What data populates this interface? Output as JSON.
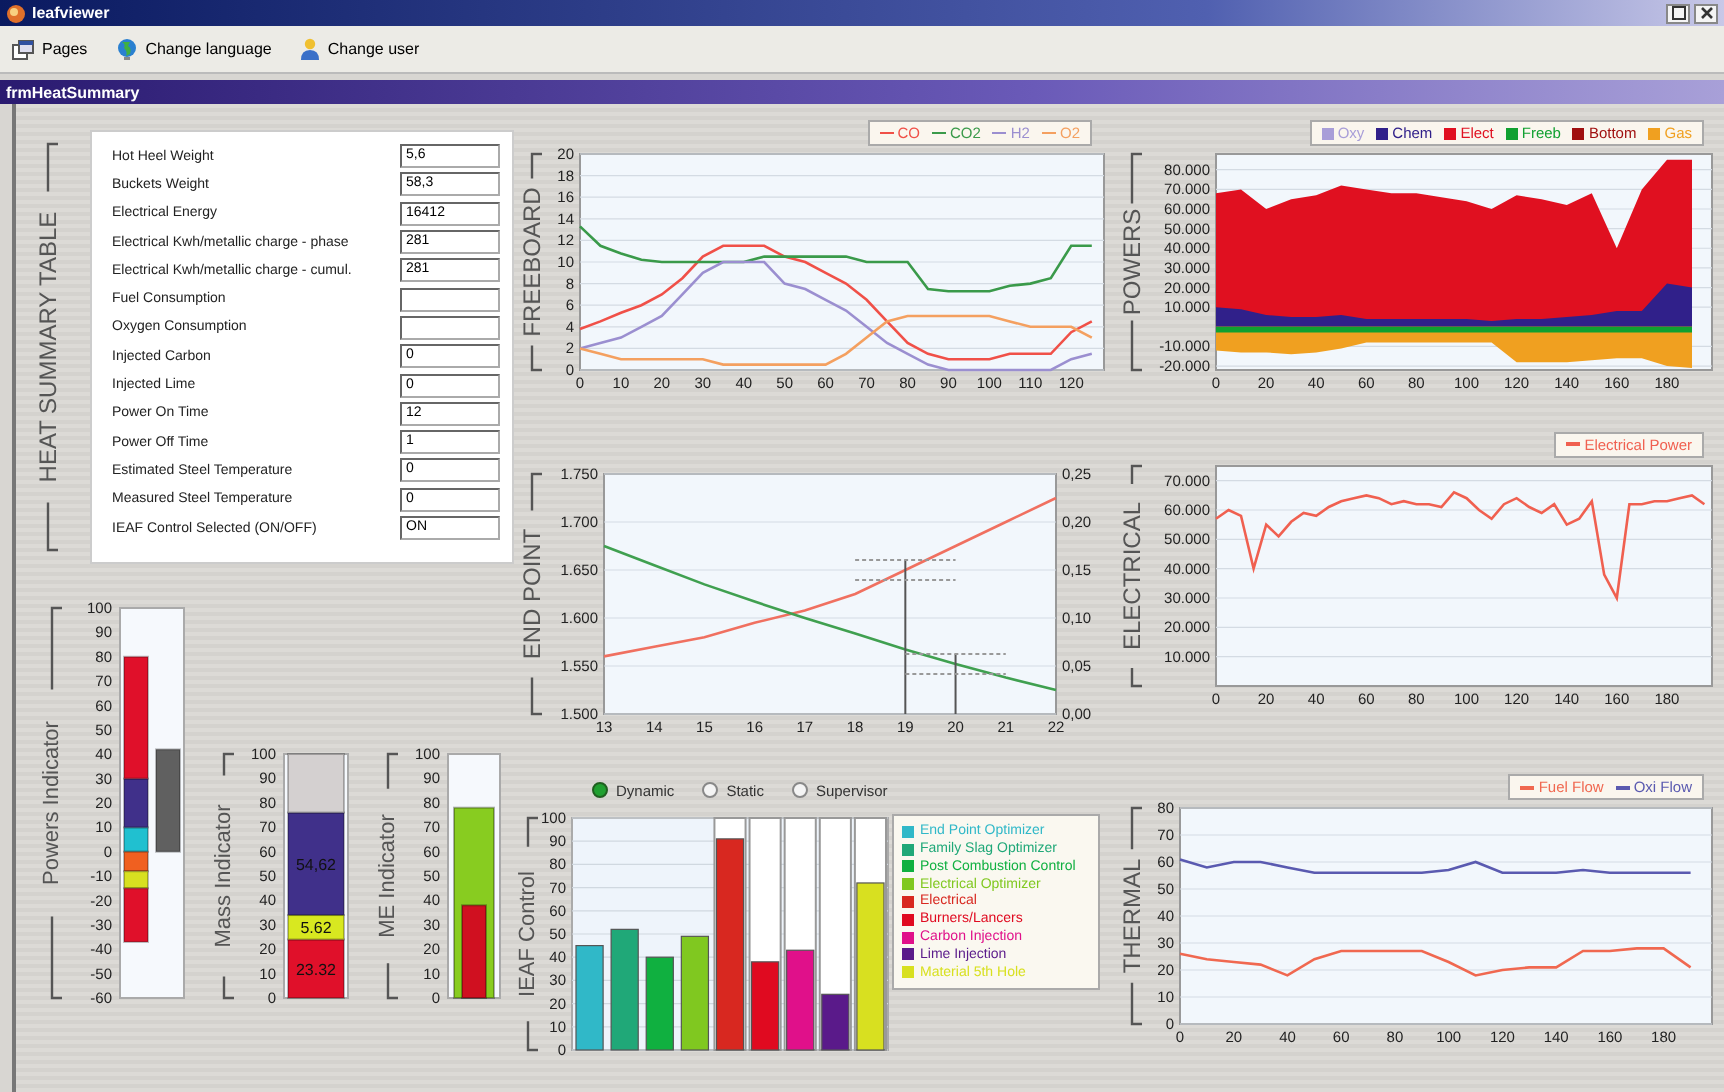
{
  "window": {
    "title": "Ieafviewer"
  },
  "menu": [
    {
      "label": "Pages",
      "kind": "pages"
    },
    {
      "label": "Change language",
      "kind": "globe"
    },
    {
      "label": "Change user",
      "kind": "user"
    }
  ],
  "form": {
    "title": "frmHeatSummary"
  },
  "heat_summary": {
    "title": "HEAT SUMMARY TABLE",
    "rows": [
      {
        "label": "Hot Heel Weight",
        "value": "5,6"
      },
      {
        "label": "Buckets Weight",
        "value": "58,3"
      },
      {
        "label": "Electrical Energy",
        "value": "16412"
      },
      {
        "label": "Electrical Kwh/metallic charge - phase",
        "value": "281"
      },
      {
        "label": "Electrical Kwh/metallic charge - cumul.",
        "value": "281"
      },
      {
        "label": "Fuel Consumption"
      },
      {
        "label": "Oxygen Consumption"
      },
      {
        "label": "Injected Carbon",
        "value": "0"
      },
      {
        "label": "Injected Lime",
        "value": "0"
      },
      {
        "label": "Power On Time",
        "value": "12"
      },
      {
        "label": "Power Off Time",
        "value": "1"
      },
      {
        "label": "Estimated Steel Temperature",
        "value": "0"
      },
      {
        "label": "Measured Steel Temperature",
        "value": "0"
      },
      {
        "label": "IEAF Control Selected (ON/OFF)",
        "value": "ON"
      }
    ]
  },
  "powers_indicator": {
    "chart_data": {
      "type": "bar",
      "stacked": true,
      "categories": [
        null,
        null
      ],
      "ylabel": "Powers Indicator",
      "ylim": [
        -60,
        100
      ],
      "yticks": [
        -60,
        -50,
        -40,
        -30,
        -20,
        -10,
        0,
        10,
        20,
        30,
        40,
        50,
        60,
        70,
        80,
        90,
        100
      ],
      "series": [
        {
          "color": "#20c0d0",
          "values": [
            10,
            null
          ]
        },
        {
          "color": "#40308a",
          "values": [
            20,
            null
          ]
        },
        {
          "color": "#e0102a",
          "values": [
            50,
            null
          ]
        },
        {
          "color": "#f06020",
          "values": [
            -8,
            null
          ]
        },
        {
          "color": "#d8e020",
          "values": [
            -7,
            null
          ]
        },
        {
          "color": "#e0102a",
          "values": [
            -22,
            null
          ]
        },
        {
          "color": "#606060",
          "values": [
            null,
            42
          ]
        }
      ]
    }
  },
  "mass_indicator": {
    "chart_data": {
      "type": "bar",
      "stacked": true,
      "categories": [
        null
      ],
      "ylabel": "Mass Indicator",
      "ylim": [
        0,
        100
      ],
      "yticks": [
        0,
        10,
        20,
        30,
        40,
        50,
        60,
        70,
        80,
        90,
        100
      ],
      "value_labels": [
        "23.32",
        "5.62",
        "54,62"
      ],
      "series": [
        {
          "color": "#e0102a",
          "values": [
            24
          ]
        },
        {
          "color": "#d8e820",
          "values": [
            10
          ]
        },
        {
          "color": "#40308a",
          "values": [
            42
          ]
        },
        {
          "color": "#d4d0d0",
          "values": [
            24
          ]
        }
      ]
    }
  },
  "me_indicator": {
    "title": "ME Indicator",
    "scale": [
      "100",
      "90",
      "80",
      "70",
      "60",
      "50",
      "40",
      "30",
      "20",
      "10",
      "0"
    ],
    "bars": [
      {
        "color": "#88cc20",
        "level": 0.78
      },
      {
        "color": "#d01020",
        "level": 0.38
      }
    ]
  },
  "freeboard": {
    "chart_data": {
      "type": "line",
      "grid": true,
      "ylabel": "FREEBOARD",
      "xlim": [
        0,
        128
      ],
      "ylim": [
        0,
        20
      ],
      "xticks": [
        0,
        10,
        20,
        30,
        40,
        50,
        60,
        70,
        80,
        90,
        100,
        110,
        120
      ],
      "yticks": [
        0,
        2,
        4,
        6,
        8,
        10,
        12,
        14,
        16,
        18,
        20
      ],
      "x": [
        0,
        5,
        10,
        15,
        20,
        25,
        30,
        35,
        40,
        45,
        50,
        55,
        60,
        65,
        70,
        75,
        80,
        85,
        90,
        95,
        100,
        105,
        110,
        115,
        120,
        125
      ],
      "series": [
        {
          "name": "CO",
          "color": "#f05048",
          "values": [
            3.8,
            4.5,
            5.3,
            6,
            7,
            8.5,
            10.5,
            11.5,
            11.5,
            11.5,
            10.5,
            10,
            9,
            8,
            6.5,
            4.5,
            2.5,
            1.5,
            1,
            1,
            1,
            1.5,
            1.5,
            1.5,
            3.5,
            4.5
          ]
        },
        {
          "name": "CO2",
          "color": "#3a9a4a",
          "values": [
            13.3,
            11.5,
            10.8,
            10.2,
            10,
            10,
            10,
            10,
            10,
            10.5,
            10.5,
            10.5,
            10.5,
            10.5,
            10,
            10,
            10,
            7.5,
            7.3,
            7.3,
            7.3,
            7.8,
            8,
            8.5,
            11.5,
            11.5
          ]
        },
        {
          "name": "H2",
          "color": "#9b8fd0",
          "values": [
            2,
            2.5,
            3,
            4,
            5,
            7,
            9,
            10,
            10,
            10,
            8,
            7.5,
            6.5,
            5.5,
            4,
            2.5,
            1.5,
            0.5,
            0,
            0,
            0,
            0,
            0,
            0,
            1,
            1.5
          ]
        },
        {
          "name": "O2",
          "color": "#f4a060",
          "values": [
            2,
            1.5,
            1,
            1,
            1,
            1,
            1,
            0.5,
            0.5,
            0.5,
            0.5,
            0.5,
            0.5,
            1.5,
            3,
            4.5,
            5,
            5,
            5,
            5,
            5,
            4.5,
            4,
            4,
            4,
            3
          ]
        }
      ]
    }
  },
  "powers": {
    "legend": [
      {
        "label": "Oxy",
        "color": "#a89ed8"
      },
      {
        "label": "Chem",
        "color": "#30208a"
      },
      {
        "label": "Elect",
        "color": "#e01020"
      },
      {
        "label": "Freeb",
        "color": "#10a030"
      },
      {
        "label": "Bottom",
        "color": "#a01010"
      },
      {
        "label": "Gas",
        "color": "#f0a020"
      }
    ],
    "chart_data": {
      "type": "area",
      "stacked": false,
      "grid": true,
      "ylabel": "POWERS",
      "xlim": [
        0,
        198
      ],
      "ylim": [
        -22000,
        88000
      ],
      "xticks": [
        0,
        20,
        40,
        60,
        80,
        100,
        120,
        140,
        160,
        180
      ],
      "yticks": [
        {
          "value": -20000,
          "label": "-20.000"
        },
        {
          "value": -10000,
          "label": "-10.000"
        },
        {
          "value": 10000,
          "label": "10.000"
        },
        {
          "value": 20000,
          "label": "20.000"
        },
        {
          "value": 30000,
          "label": "30.000"
        },
        {
          "value": 40000,
          "label": "40.000"
        },
        {
          "value": 50000,
          "label": "50.000"
        },
        {
          "value": 60000,
          "label": "60.000"
        },
        {
          "value": 70000,
          "label": "70.000"
        },
        {
          "value": 80000,
          "label": "80.000"
        }
      ],
      "x": [
        0,
        10,
        20,
        30,
        40,
        50,
        60,
        70,
        80,
        90,
        100,
        110,
        120,
        130,
        140,
        150,
        160,
        170,
        180,
        190
      ],
      "series": [
        {
          "color": "#e01020",
          "values": [
            68000,
            70000,
            60000,
            65000,
            67000,
            72000,
            70000,
            68000,
            68000,
            66000,
            64000,
            60000,
            67000,
            65000,
            62000,
            68000,
            40000,
            70000,
            85000,
            85000
          ]
        },
        {
          "color": "#30208a",
          "values": [
            10000,
            9000,
            6000,
            5000,
            5000,
            6000,
            4000,
            4000,
            4000,
            4000,
            4000,
            3000,
            4000,
            4000,
            5000,
            6000,
            8000,
            8000,
            22000,
            20000
          ]
        },
        {
          "color": "#f0a020",
          "values": [
            -12000,
            -13000,
            -13000,
            -14000,
            -13000,
            -11000,
            -8000,
            -8000,
            -8000,
            -8000,
            -8000,
            -8000,
            -18000,
            -18000,
            -18000,
            -17000,
            -16000,
            -16000,
            -20000,
            -21000
          ]
        },
        {
          "color": "#10a030",
          "values": [
            -3000,
            -3000,
            -3000,
            -3000,
            -3000,
            -3000,
            -3000,
            -3000,
            -3000,
            -3000,
            -3000,
            -3000,
            -3000,
            -3000,
            -3000,
            -3000,
            -3000,
            -3000,
            -3000,
            -3000
          ]
        }
      ]
    }
  },
  "end_point": {
    "chart_data": {
      "type": "line",
      "grid": true,
      "ylabel": "END POINT",
      "xlim": [
        13,
        22
      ],
      "ylim": [
        1500,
        1750
      ],
      "xticks": [
        13,
        14,
        15,
        16,
        17,
        18,
        19,
        20,
        21,
        22
      ],
      "yticks": [
        {
          "value": 1500,
          "label": "1.500"
        },
        {
          "value": 1550,
          "label": "1.550"
        },
        {
          "value": 1600,
          "label": "1.600"
        },
        {
          "value": 1650,
          "label": "1.650"
        },
        {
          "value": 1700,
          "label": "1.700"
        },
        {
          "value": 1750,
          "label": "1.750"
        }
      ],
      "y2lim": [
        0,
        0.25
      ],
      "y2ticks": [
        {
          "value": 0,
          "label": "0,00"
        },
        {
          "value": 0.05,
          "label": "0,05"
        },
        {
          "value": 0.1,
          "label": "0,10"
        },
        {
          "value": 0.15,
          "label": "0,15"
        },
        {
          "value": 0.2,
          "label": "0,20"
        },
        {
          "value": 0.25,
          "label": "0,25"
        }
      ],
      "x": [
        13,
        14,
        15,
        16,
        17,
        18,
        19,
        20,
        21,
        22
      ],
      "series": [
        {
          "color": "#f07060",
          "values": [
            1560,
            1570,
            1580,
            1595,
            1608,
            1625,
            1650,
            1675,
            1700,
            1725
          ]
        },
        {
          "color": "#40a050",
          "values": [
            1675,
            1655,
            1635,
            1617,
            1600,
            1584,
            1567,
            1552,
            1538,
            1525
          ]
        }
      ],
      "ref_lines": [
        {
          "axis": "x",
          "value": 19
        },
        {
          "axis": "x",
          "value": 20
        }
      ]
    }
  },
  "electrical": {
    "chart_data": {
      "type": "line",
      "grid": true,
      "ylabel": "ELECTRICAL",
      "xlim": [
        0,
        198
      ],
      "ylim": [
        0,
        75000
      ],
      "xticks": [
        0,
        20,
        40,
        60,
        80,
        100,
        120,
        140,
        160,
        180
      ],
      "yticks": [
        {
          "value": 10000,
          "label": "10.000"
        },
        {
          "value": 20000,
          "label": "20.000"
        },
        {
          "value": 30000,
          "label": "30.000"
        },
        {
          "value": 40000,
          "label": "40.000"
        },
        {
          "value": 50000,
          "label": "50.000"
        },
        {
          "value": 60000,
          "label": "60.000"
        },
        {
          "value": 70000,
          "label": "70.000"
        }
      ],
      "x": [
        0,
        5,
        10,
        15,
        20,
        25,
        30,
        35,
        40,
        45,
        50,
        55,
        60,
        65,
        70,
        75,
        80,
        85,
        90,
        95,
        100,
        105,
        110,
        115,
        120,
        125,
        130,
        135,
        140,
        145,
        150,
        155,
        160,
        165,
        170,
        175,
        180,
        185,
        190,
        195
      ],
      "series": [
        {
          "name": "Electrical Power",
          "color": "#f06050",
          "values": [
            57000,
            60000,
            58000,
            40000,
            55000,
            51000,
            56000,
            59000,
            58000,
            61000,
            63000,
            64000,
            65000,
            64000,
            62000,
            63000,
            62000,
            62000,
            61000,
            66000,
            64000,
            60000,
            57000,
            62000,
            64000,
            61000,
            59000,
            62000,
            55000,
            57000,
            63000,
            38000,
            30000,
            62000,
            62000,
            63000,
            63000,
            64000,
            65000,
            62000
          ]
        }
      ]
    }
  },
  "ieaf": {
    "modes": [
      {
        "label": "Dynamic",
        "selected": true
      },
      {
        "label": "Static",
        "selected": false
      },
      {
        "label": "Supervisor",
        "selected": false
      }
    ],
    "legend": [
      {
        "label": "End Point Optimizer",
        "color": "#30b8c8",
        "boxed": false
      },
      {
        "label": "Family Slag Optimizer",
        "color": "#20a878",
        "boxed": false
      },
      {
        "label": "Post Combustion Control",
        "color": "#10b040",
        "boxed": false
      },
      {
        "label": "Electrical Optimizer",
        "color": "#80c820",
        "boxed": false
      },
      {
        "label": "Electrical",
        "color": "#d82820",
        "boxed": true
      },
      {
        "label": "Burners/Lancers",
        "color": "#e00a20",
        "boxed": true
      },
      {
        "label": "Carbon Injection",
        "color": "#e0108a",
        "boxed": true
      },
      {
        "label": "Lime Injection",
        "color": "#5a1a8a",
        "boxed": true
      },
      {
        "label": "Material 5th Hole",
        "color": "#d8e020",
        "boxed": true
      }
    ],
    "chart_data": {
      "type": "bar",
      "grid": true,
      "ylabel": "IEAF Control",
      "ylim": [
        0,
        100
      ],
      "yticks": [
        0,
        10,
        20,
        30,
        40,
        50,
        60,
        70,
        80,
        90,
        100
      ],
      "values": [
        45,
        52,
        40,
        49,
        91,
        38,
        43,
        24,
        72
      ]
    }
  },
  "thermal": {
    "chart_data": {
      "type": "line",
      "grid": true,
      "ylabel": "THERMAL",
      "xlim": [
        0,
        198
      ],
      "ylim": [
        0,
        80
      ],
      "xticks": [
        0,
        20,
        40,
        60,
        80,
        100,
        120,
        140,
        160,
        180
      ],
      "yticks": [
        0,
        10,
        20,
        30,
        40,
        50,
        60,
        70,
        80
      ],
      "x": [
        0,
        10,
        20,
        30,
        40,
        50,
        60,
        70,
        80,
        90,
        100,
        110,
        120,
        130,
        140,
        150,
        160,
        170,
        180,
        190
      ],
      "series": [
        {
          "name": "Fuel Flow",
          "color": "#f06850",
          "values": [
            26,
            24,
            23,
            22,
            18,
            24,
            27,
            27,
            27,
            27,
            23,
            18,
            20,
            21,
            21,
            27,
            27,
            28,
            28,
            21
          ]
        },
        {
          "name": "Oxi Flow",
          "color": "#5a5ab0",
          "values": [
            61,
            58,
            60,
            60,
            58,
            56,
            56,
            56,
            56,
            56,
            57,
            60,
            56,
            56,
            56,
            57,
            56,
            56,
            56,
            56
          ]
        }
      ]
    }
  }
}
